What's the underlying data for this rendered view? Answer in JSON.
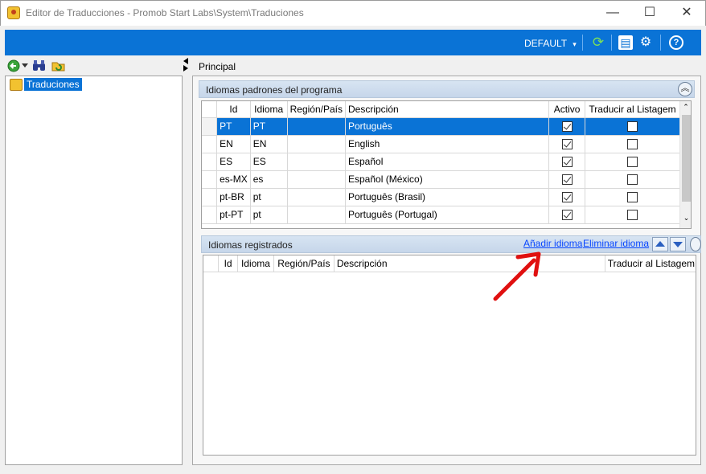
{
  "window": {
    "title": "Editor de Traducciones - Promob Start Labs\\System\\Traduciones",
    "minimize": "—",
    "maximize": "☐",
    "close": "✕"
  },
  "toolbar": {
    "profile_label": "DEFAULT",
    "profile_caret": "▾",
    "refresh_icon": "⟳",
    "layout_icon": "▤",
    "settings_icon": "⚙",
    "help_icon": "?"
  },
  "left": {
    "tree": [
      {
        "label": "Traduciones",
        "selected": true
      }
    ]
  },
  "main": {
    "tab_label": "Principal",
    "default_languages": {
      "title": "Idiomas padrones del programa",
      "collapse_glyph": "︽",
      "columns": [
        "Id",
        "Idioma",
        "Región/País",
        "Descripción",
        "Activo",
        "Traducir al Listagem"
      ],
      "rows": [
        {
          "id": "PT",
          "idioma": "PT",
          "region": "",
          "desc": "Português",
          "activo": true,
          "traducir": false,
          "selected": true
        },
        {
          "id": "EN",
          "idioma": "EN",
          "region": "",
          "desc": "English",
          "activo": true,
          "traducir": false,
          "selected": false
        },
        {
          "id": "ES",
          "idioma": "ES",
          "region": "",
          "desc": "Español",
          "activo": true,
          "traducir": false,
          "selected": false
        },
        {
          "id": "es-MX",
          "idioma": "es",
          "region": "",
          "desc": "Español (México)",
          "activo": true,
          "traducir": false,
          "selected": false
        },
        {
          "id": "pt-BR",
          "idioma": "pt",
          "region": "",
          "desc": "Português (Brasil)",
          "activo": true,
          "traducir": false,
          "selected": false
        },
        {
          "id": "pt-PT",
          "idioma": "pt",
          "region": "",
          "desc": "Português (Portugal)",
          "activo": true,
          "traducir": false,
          "selected": false
        }
      ]
    },
    "registered_languages": {
      "title": "Idiomas registrados",
      "add_link": "Añadir idioma",
      "remove_link": "Eliminar idioma",
      "columns": [
        "Id",
        "Idioma",
        "Región/País",
        "Descripción",
        "Traducir al Listagem"
      ]
    }
  },
  "colors": {
    "accent": "#0a73d6",
    "annotation_arrow": "#e01010"
  }
}
